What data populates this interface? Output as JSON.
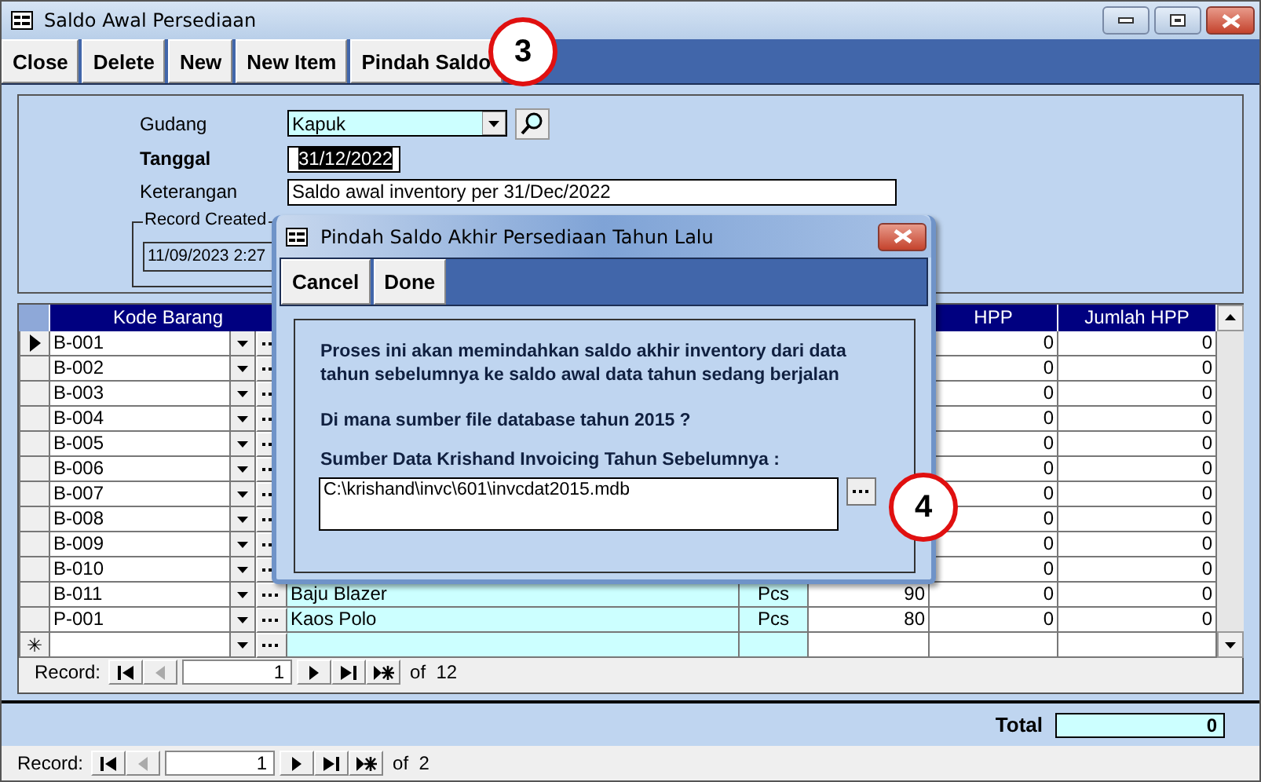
{
  "window": {
    "title": "Saldo Awal Persediaan"
  },
  "toolbar": [
    "Close",
    "Delete",
    "New",
    "New Item",
    "Pindah Saldo"
  ],
  "form": {
    "gudang": {
      "label": "Gudang",
      "value": "Kapuk"
    },
    "tanggal": {
      "label": "Tanggal",
      "value": "31/12/2022",
      "selected": true
    },
    "keterangan": {
      "label": "Keterangan",
      "value": "Saldo awal inventory per 31/Dec/2022"
    },
    "record_created": {
      "label": "Record Created",
      "value": "11/09/2023 2:27"
    }
  },
  "grid": {
    "columns": [
      "Kode Barang",
      "HPP",
      "Jumlah HPP"
    ],
    "rows": [
      {
        "current": true,
        "code": "B-001",
        "hpp": "0",
        "total": "0"
      },
      {
        "current": false,
        "code": "B-002",
        "hpp": "0",
        "total": "0"
      },
      {
        "current": false,
        "code": "B-003",
        "hpp": "0",
        "total": "0"
      },
      {
        "current": false,
        "code": "B-004",
        "hpp": "0",
        "total": "0"
      },
      {
        "current": false,
        "code": "B-005",
        "hpp": "0",
        "total": "0"
      },
      {
        "current": false,
        "code": "B-006",
        "hpp": "0",
        "total": "0"
      },
      {
        "current": false,
        "code": "B-007",
        "hpp": "0",
        "total": "0"
      },
      {
        "current": false,
        "code": "B-008",
        "hpp": "0",
        "total": "0"
      },
      {
        "current": false,
        "code": "B-009",
        "hpp": "0",
        "total": "0"
      },
      {
        "current": false,
        "code": "B-010",
        "hpp": "0",
        "total": "0"
      },
      {
        "current": false,
        "code": "B-011",
        "name": "Baju Blazer",
        "unit": "Pcs",
        "qty": "90",
        "hpp": "0",
        "total": "0"
      },
      {
        "current": false,
        "code": "P-001",
        "name": "Kaos Polo",
        "unit": "Pcs",
        "qty": "80",
        "hpp": "0",
        "total": "0"
      }
    ],
    "new_row": {
      "marker": "✳"
    },
    "navigator": {
      "label": "Record:",
      "current": "1",
      "count": "of  12"
    }
  },
  "total": {
    "label": "Total",
    "value": "0"
  },
  "navigator": {
    "label": "Record:",
    "current": "1",
    "count": "of  2"
  },
  "dialog": {
    "title": "Pindah Saldo Akhir Persediaan Tahun Lalu",
    "buttons": [
      "Cancel",
      "Done"
    ],
    "message": "Proses ini akan memindahkan saldo akhir inventory dari data tahun sebelumnya ke saldo awal data tahun sedang berjalan",
    "question": "Di mana sumber file database tahun 2015 ?",
    "source_label": "Sumber Data Krishand Invoicing Tahun Sebelumnya :",
    "source_value": "C:\\krishand\\invc\\601\\invcdat2015.mdb"
  },
  "callouts": [
    "3",
    "4"
  ]
}
